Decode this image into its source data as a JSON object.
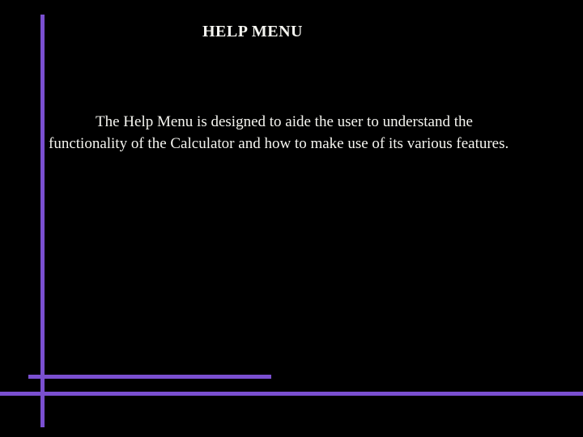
{
  "slide": {
    "title": "HELP MENU",
    "body": "The Help Menu is designed to aide the user to understand the functionality of the Calculator and how to make use of its various features."
  }
}
